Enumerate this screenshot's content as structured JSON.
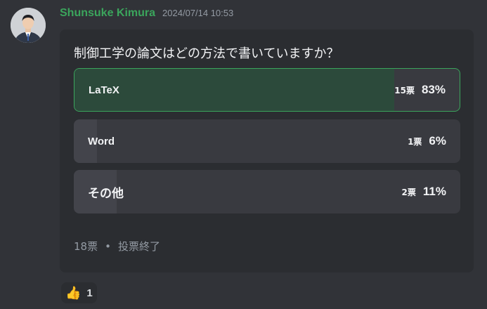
{
  "message": {
    "username": "Shunsuke Kimura",
    "timestamp": "2024/07/14 10:53",
    "avatar_icon": "user-avatar-icon"
  },
  "poll": {
    "question": "制御工学の論文はどの方法で書いていますか？",
    "options": [
      {
        "label": "LaTeX",
        "votes": "15票",
        "percent": "83%",
        "fraction": 0.83,
        "selected": true
      },
      {
        "label": "Word",
        "votes": "1票",
        "percent": "6%",
        "fraction": 0.06,
        "selected": false
      },
      {
        "label": "その他",
        "votes": "2票",
        "percent": "11%",
        "fraction": 0.11,
        "selected": false
      }
    ],
    "total_votes": "18票",
    "separator": "•",
    "status": "投票終了"
  },
  "reactions": [
    {
      "emoji": "👍",
      "icon": "thumbs-up-icon",
      "count": "1"
    }
  ],
  "colors": {
    "background": "#313338",
    "card": "#2b2d31",
    "username": "#3ba55c",
    "selected_border": "#3ba55c",
    "selected_fill": "#2c4a3b",
    "option_bg": "#393a40",
    "option_fill": "#43444b"
  }
}
